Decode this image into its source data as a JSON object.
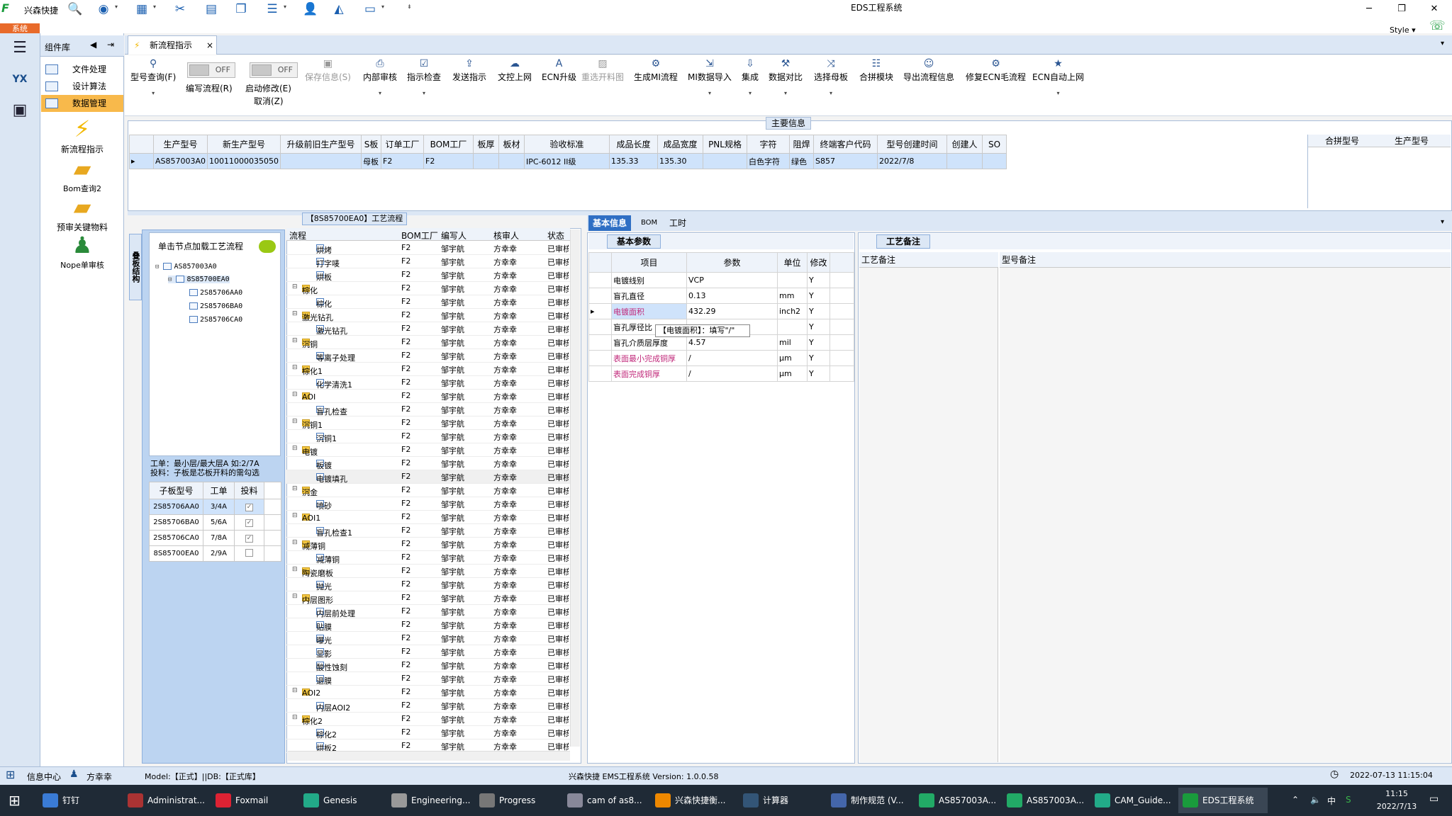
{
  "app": {
    "name": "兴森快捷",
    "window_title": "EDS工程系统",
    "style_label": "Style",
    "sys_button": "系统"
  },
  "component_panel": {
    "title": "组件库",
    "items": [
      "文件处理",
      "设计算法",
      "数据管理"
    ],
    "big_items": [
      "新流程指示",
      "Bom查询2",
      "预审关键物料",
      "Nope单审核"
    ]
  },
  "tab": {
    "label": "新流程指示",
    "close": "×"
  },
  "toolbar": {
    "model_query": "型号查询(F)",
    "write_flow": "编写流程(R)",
    "start_modify": "启动修改(E)",
    "cancel": "取消(Z)",
    "toggle_off": "OFF",
    "buttons": [
      "保存信息(S)",
      "内部审核",
      "指示检查",
      "发送指示",
      "文控上网",
      "ECN升级",
      "重选开料图",
      "生成MI流程",
      "MI数据导入",
      "集成",
      "数据对比",
      "选择母板",
      "合拼模块",
      "导出流程信息",
      "修复ECN毛流程",
      "ECN自动上网"
    ]
  },
  "main_info": {
    "title": "主要信息",
    "columns": [
      "生产型号",
      "新生产型号",
      "升级前旧生产型号",
      "S板",
      "订单工厂",
      "BOM工厂",
      "板厚",
      "板材",
      "验收标准",
      "成品长度",
      "成品宽度",
      "PNL规格",
      "字符",
      "阻焊",
      "终端客户代码",
      "型号创建时间",
      "创建人",
      "SO"
    ],
    "row": [
      "AS857003A0",
      "10011000035050",
      "",
      "母板",
      "F2",
      "F2",
      "",
      "",
      "IPC-6012 II级",
      "135.33",
      "135.30",
      "",
      "白色字符",
      "绿色",
      "S857",
      "2022/7/8",
      "",
      ""
    ],
    "right_columns": [
      "合拼型号",
      "生产型号"
    ]
  },
  "left_pane": {
    "vertical_tab": "叠板结构",
    "hint": "单击节点加载工艺流程",
    "tree": [
      "AS857003A0",
      "8S85700EA0",
      "2S85706AA0",
      "2S85706BA0",
      "2S85706CA0"
    ],
    "note_line1": "工单：最小层/最大层A 如:2/7A",
    "note_line2": "投料：子板是芯板开料的需勾选",
    "sub_columns": [
      "子板型号",
      "工单",
      "投料"
    ],
    "sub_rows": [
      {
        "model": "2S85706AA0",
        "order": "3/4A",
        "checked": "✓"
      },
      {
        "model": "2S85706BA0",
        "order": "5/6A",
        "checked": "✓"
      },
      {
        "model": "2S85706CA0",
        "order": "7/8A",
        "checked": "✓"
      },
      {
        "model": "8S85700EA0",
        "order": "2/9A",
        "checked": ""
      }
    ]
  },
  "flow": {
    "title": "【8S85700EA0】工艺流程",
    "columns": [
      "流程",
      "BOM工厂",
      "编写人",
      "核审人",
      "状态"
    ],
    "factory": "F2",
    "writer": "邹宇航",
    "reviewer": "方幸幸",
    "status": "已审核",
    "rows": [
      {
        "name": "烘烤",
        "folder": false
      },
      {
        "name": "打字唛",
        "folder": false
      },
      {
        "name": "烘板",
        "folder": false
      },
      {
        "name": "棕化",
        "folder": true
      },
      {
        "name": "棕化",
        "folder": false
      },
      {
        "name": "激光钻孔",
        "folder": true
      },
      {
        "name": "激光钻孔",
        "folder": false
      },
      {
        "name": "沉铜",
        "folder": true
      },
      {
        "name": "等离子处理",
        "folder": false
      },
      {
        "name": "棕化1",
        "folder": true
      },
      {
        "name": "化学清洗1",
        "folder": false
      },
      {
        "name": "AOI",
        "folder": true
      },
      {
        "name": "盲孔检查",
        "folder": false
      },
      {
        "name": "沉铜1",
        "folder": true
      },
      {
        "name": "沉铜1",
        "folder": false
      },
      {
        "name": "电镀",
        "folder": true
      },
      {
        "name": "板镀",
        "folder": false
      },
      {
        "name": "电镀填孔",
        "folder": false
      },
      {
        "name": "沉金",
        "folder": true
      },
      {
        "name": "喷砂",
        "folder": false
      },
      {
        "name": "AOI1",
        "folder": true
      },
      {
        "name": "盲孔检查1",
        "folder": false
      },
      {
        "name": "减薄铜",
        "folder": true
      },
      {
        "name": "减薄铜",
        "folder": false
      },
      {
        "name": "陶瓷磨板",
        "folder": true
      },
      {
        "name": "抛光",
        "folder": false
      },
      {
        "name": "内层图形",
        "folder": true
      },
      {
        "name": "内层前处理",
        "folder": false
      },
      {
        "name": "贴膜",
        "folder": false
      },
      {
        "name": "曝光",
        "folder": false
      },
      {
        "name": "显影",
        "folder": false
      },
      {
        "name": "酸性蚀刻",
        "folder": false
      },
      {
        "name": "退膜",
        "folder": false
      },
      {
        "name": "AOI2",
        "folder": true
      },
      {
        "name": "内层AOI2",
        "folder": false
      },
      {
        "name": "棕化2",
        "folder": true
      },
      {
        "name": "棕化2",
        "folder": false
      },
      {
        "name": "烘板2",
        "folder": false
      }
    ]
  },
  "info_tabs": [
    "基本信息",
    "BOM",
    "工时"
  ],
  "basic": {
    "title": "基本参数",
    "columns": [
      "项目",
      "参数",
      "单位",
      "修改"
    ],
    "rows": [
      {
        "item": "电镀线别",
        "value": "VCP",
        "unit": "",
        "mod": "Y"
      },
      {
        "item": "盲孔直径",
        "value": "0.13",
        "unit": "mm",
        "mod": "Y"
      },
      {
        "item": "电镀面积",
        "value": "432.29",
        "unit": "inch2",
        "mod": "Y"
      },
      {
        "item": "盲孔厚径比",
        "value": "",
        "unit": "",
        "mod": "Y"
      },
      {
        "item": "盲孔介质层厚度",
        "value": "4.57",
        "unit": "mil",
        "mod": "Y"
      },
      {
        "item": "表面最小完成铜厚",
        "value": "/",
        "unit": "μm",
        "mod": "Y"
      },
      {
        "item": "表面完成铜厚",
        "value": "/",
        "unit": "μm",
        "mod": "Y"
      }
    ],
    "tooltip": "【电镀面积】：填写\"/\""
  },
  "remark": {
    "title": "工艺备注",
    "col1": "工艺备注",
    "col2": "型号备注"
  },
  "status": {
    "info_center": "信息中心",
    "user": "方幸幸",
    "model": "Model:【正式】||DB:【正式库】",
    "version": "兴森快捷 EMS工程系统 Version: 1.0.0.58",
    "datetime": "2022-07-13 11:15:04"
  },
  "taskbar": {
    "items": [
      "钉钉",
      "Administrat...",
      "Foxmail",
      "Genesis",
      "Engineering...",
      "Progress",
      "cam of as8...",
      "兴森快捷衡...",
      "计算器",
      "制作规范 (V...",
      "AS857003A...",
      "AS857003A...",
      "CAM_Guide...",
      "EDS工程系统"
    ],
    "time": "11:15",
    "date": "2022/7/13",
    "ime": "中"
  }
}
